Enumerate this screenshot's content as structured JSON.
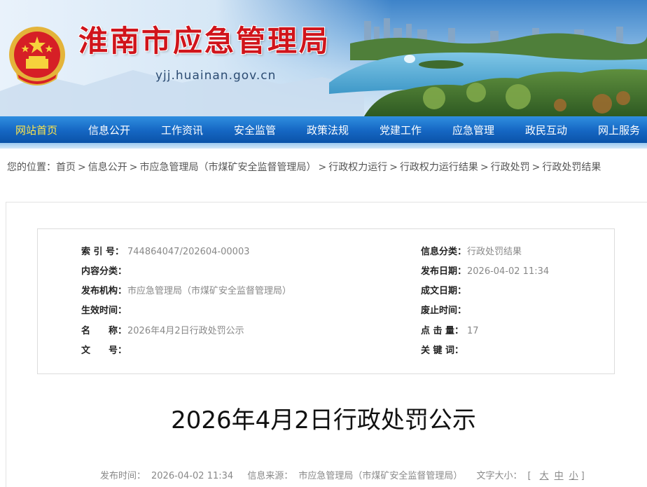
{
  "header": {
    "site_title": "淮南市应急管理局",
    "site_domain": "yjj.huainan.gov.cn",
    "emblem_icon": "national-emblem-icon"
  },
  "nav": {
    "items": [
      {
        "label": "网站首页",
        "active": true
      },
      {
        "label": "信息公开"
      },
      {
        "label": "工作资讯"
      },
      {
        "label": "安全监管"
      },
      {
        "label": "政策法规"
      },
      {
        "label": "党建工作"
      },
      {
        "label": "应急管理"
      },
      {
        "label": "政民互动"
      },
      {
        "label": "网上服务"
      }
    ]
  },
  "breadcrumb": {
    "prefix": "您的位置：",
    "items": [
      "首页",
      "信息公开",
      "市应急管理局（市煤矿安全监督管理局）",
      "行政权力运行",
      "行政权力运行结果",
      "行政处罚",
      "行政处罚结果"
    ]
  },
  "meta": {
    "index_label": "索 引 号：",
    "index_value": "744864047/202604-00003",
    "category_label": "信息分类：",
    "category_value": "行政处罚结果",
    "content_type_label": "内容分类：",
    "content_type_value": "",
    "publish_date_label": "发布日期：",
    "publish_date_value": "2026-04-02 11:34",
    "publisher_label": "发布机构：",
    "publisher_value": "市应急管理局（市煤矿安全监督管理局）",
    "written_date_label": "成文日期：",
    "written_date_value": "",
    "effective_label": "生效时间：",
    "effective_value": "",
    "expire_label": "废止时间：",
    "expire_value": "",
    "name_label": "名　　称：",
    "name_value": "2026年4月2日行政处罚公示",
    "clicks_label": "点 击 量：",
    "clicks_value": "17",
    "doc_no_label": "文　　号：",
    "doc_no_value": "",
    "keywords_label": "关 键 词：",
    "keywords_value": ""
  },
  "article": {
    "title": "2026年4月2日行政处罚公示",
    "publish_time_label": "发布时间：",
    "publish_time_value": "2026-04-02 11:34",
    "source_label": "信息来源：",
    "source_value": "市应急管理局（市煤矿安全监督管理局）",
    "font_size_label": "文字大小：",
    "font_open": "[",
    "font_large": "大",
    "font_medium": "中",
    "font_small": "小",
    "font_close": "]"
  },
  "colors": {
    "title_red": "#d0141b",
    "nav_blue": "#1566c2",
    "nav_active": "#ffe64a"
  }
}
